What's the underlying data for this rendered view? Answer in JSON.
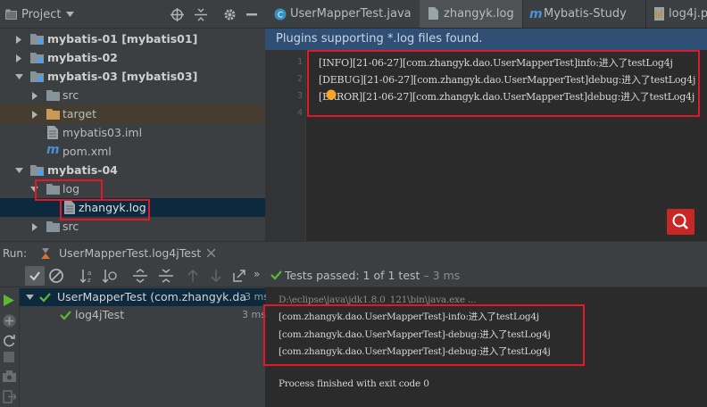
{
  "project_panel": {
    "title": "Project",
    "tree": [
      {
        "label": "mybatis-01",
        "suffix": "[mybatis01]"
      },
      {
        "label": "mybatis-02",
        "suffix": ""
      },
      {
        "label": "mybatis-03",
        "suffix": "[mybatis03]"
      },
      {
        "label": "src"
      },
      {
        "label": "target"
      },
      {
        "label": "mybatis03.iml"
      },
      {
        "label": "pom.xml"
      },
      {
        "label": "mybatis-04"
      },
      {
        "label": "log"
      },
      {
        "label": "zhangyk.log"
      },
      {
        "label": "src"
      }
    ]
  },
  "editor": {
    "tabs": [
      "UserMapperTest.java",
      "zhangyk.log",
      "Mybatis-Study",
      "log4j.p"
    ],
    "banner": "Plugins supporting *.log files found.",
    "line_numbers": [
      "1",
      "2",
      "3",
      "4"
    ],
    "lines": [
      "[INFO][21-06-27][com.zhangyk.dao.UserMapperTest]info:进入了testLog4j",
      "[DEBUG][21-06-27][com.zhangyk.dao.UserMapperTest]debug:进入了testLog4j",
      "[ERROR][21-06-27][com.zhangyk.dao.UserMapperTest]debug:进入了testLog4j"
    ]
  },
  "run_panel": {
    "run_label": "Run:",
    "config_tab": "UserMapperTest.log4jTest",
    "status_prefix": "Tests passed:",
    "status_count": "1 of 1 test",
    "status_time": "– 3 ms",
    "test_tree": [
      {
        "label": "UserMapperTest (com.zhangyk.da",
        "time": "3 ms"
      },
      {
        "label": "log4jTest",
        "time": "3 ms"
      }
    ],
    "console": {
      "cmd": "D:\\eclipse\\java\\jdk1.8.0_121\\bin\\java.exe ...",
      "lines": [
        "[com.zhangyk.dao.UserMapperTest]-info:进入了testLog4j",
        "[com.zhangyk.dao.UserMapperTest]-debug:进入了testLog4j",
        "[com.zhangyk.dao.UserMapperTest]-debug:进入了testLog4j"
      ],
      "exit": "Process finished with exit code 0"
    }
  },
  "colors": {
    "accent_red": "#e0192a",
    "selection": "#0d293e",
    "pass_green": "#5fb832"
  }
}
